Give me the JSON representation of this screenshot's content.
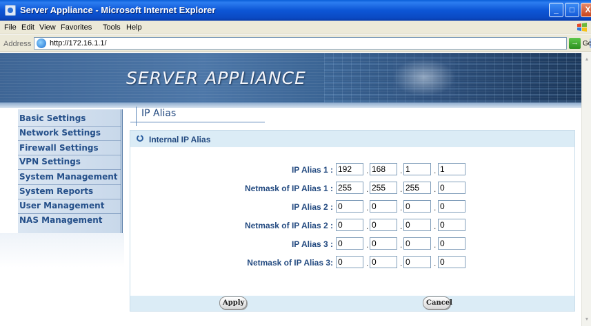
{
  "window": {
    "title": "Server Appliance - Microsoft Internet Explorer",
    "min_label": "_",
    "max_label": "□",
    "close_label": "X"
  },
  "menubar": {
    "items": [
      "File",
      "Edit",
      "View",
      "Favorites",
      "Tools",
      "Help"
    ]
  },
  "addressbar": {
    "label": "Address",
    "url": "http://172.16.1.1/",
    "go_label": "Go"
  },
  "banner": {
    "brand": "SERVER APPLIANCE"
  },
  "sidebar": {
    "items": [
      {
        "label": "Basic Settings"
      },
      {
        "label": "Network Settings"
      },
      {
        "label": "Firewall Settings"
      },
      {
        "label": "VPN Settings"
      },
      {
        "label": "System Management"
      },
      {
        "label": "System Reports"
      },
      {
        "label": "User Management"
      },
      {
        "label": "NAS Management"
      }
    ]
  },
  "content": {
    "title": "IP Alias",
    "panel_title": "Internal IP Alias",
    "rows": [
      {
        "label": "IP Alias 1 :",
        "octets": [
          "192",
          "168",
          "1",
          "1"
        ]
      },
      {
        "label": "Netmask of IP Alias 1 :",
        "octets": [
          "255",
          "255",
          "255",
          "0"
        ]
      },
      {
        "label": "IP Alias 2 :",
        "octets": [
          "0",
          "0",
          "0",
          "0"
        ]
      },
      {
        "label": "Netmask of IP Alias 2 :",
        "octets": [
          "0",
          "0",
          "0",
          "0"
        ]
      },
      {
        "label": "IP Alias 3 :",
        "octets": [
          "0",
          "0",
          "0",
          "0"
        ]
      },
      {
        "label": "Netmask of IP Alias 3:",
        "octets": [
          "0",
          "0",
          "0",
          "0"
        ]
      }
    ],
    "apply_label": "Apply",
    "cancel_label": "Cancel"
  }
}
